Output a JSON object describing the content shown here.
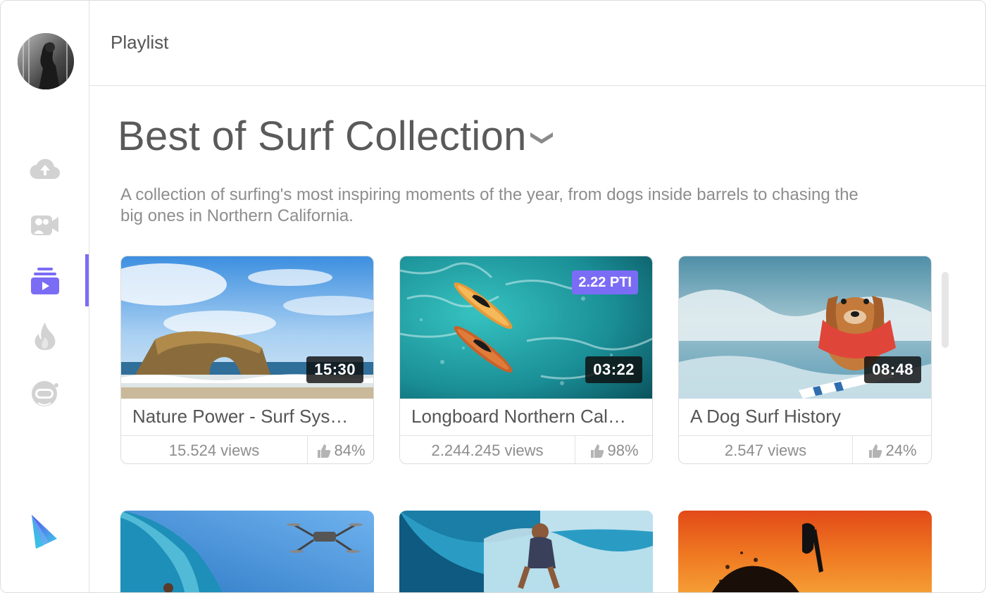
{
  "header": {
    "title": "Playlist"
  },
  "sidebar": {
    "items": [
      {
        "icon": "cloud-upload-icon"
      },
      {
        "icon": "video-camera-icon"
      },
      {
        "icon": "playlist-icon",
        "active": true
      },
      {
        "icon": "flame-icon"
      },
      {
        "icon": "astronaut-icon"
      }
    ],
    "accent": "#7b6cf6"
  },
  "playlist": {
    "title": "Best of Surf Collection",
    "description": "A collection of surfing's most inspiring moments of the year, from dogs inside barrels to chasing the big ones in Northern California."
  },
  "videos": [
    {
      "title": "Nature Power - Surf Sys…",
      "duration": "15:30",
      "views": "15.524 views",
      "likes": "84%"
    },
    {
      "title": "Longboard Northern Cal…",
      "duration": "03:22",
      "views": "2.244.245 views",
      "likes": "98%",
      "badge": "2.22 PTI"
    },
    {
      "title": "A Dog Surf History",
      "duration": "08:48",
      "views": "2.547 views",
      "likes": "24%"
    }
  ],
  "colors": {
    "accent": "#7b6cf6",
    "text": "#555555",
    "muted": "#8d8d8d"
  }
}
